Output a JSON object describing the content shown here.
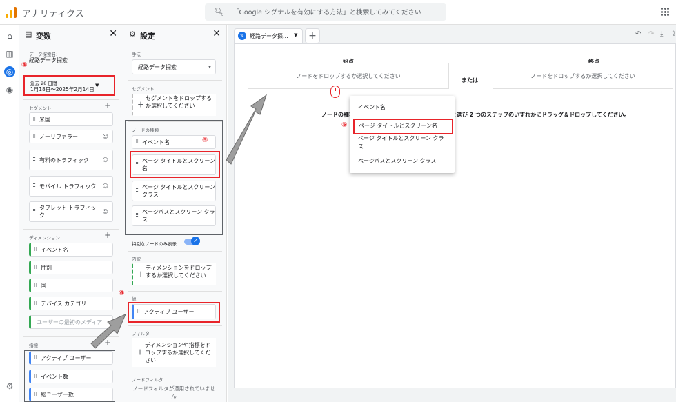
{
  "header": {
    "app_title": "アナリティクス",
    "search_placeholder": "「Google シグナルを有効にする方法」と検索してみてください"
  },
  "left_nav": {
    "icons": [
      "home-icon",
      "reports-icon",
      "explore-icon",
      "advertising-icon",
      "settings-icon"
    ]
  },
  "variables_panel": {
    "title": "変数",
    "exploration_name_label": "データ探索名:",
    "exploration_name": "経路データ探索",
    "date_range_label": "過去 28 日間",
    "date_range": "1月18日～2025年2月14日",
    "segments_label": "セグメント",
    "segments": [
      "米国",
      "ノーリファラー",
      "有料のトラフィック",
      "モバイル トラフィック",
      "タブレット トラフィック"
    ],
    "dimensions_label": "ディメンション",
    "dimensions": [
      "イベント名",
      "性別",
      "国",
      "デバイス カテゴリ",
      "ユーザーの最初のメディア"
    ],
    "metrics_label": "指標",
    "metrics": [
      "アクティブ ユーザー",
      "イベント数",
      "総ユーザー数"
    ]
  },
  "settings_panel": {
    "title": "設定",
    "technique_label": "手法",
    "technique_value": "経路データ探索",
    "segment_label": "セグメント",
    "segment_drop": "セグメントをドロップするか選択してください",
    "node_type_label": "ノードの種類",
    "node_types": [
      "イベント名",
      "ページ タイトルとスクリーン名",
      "ページ タイトルとスクリーン クラス",
      "ページパスとスクリーン クラス"
    ],
    "unique_nodes_label": "特別なノードのみ表示",
    "breakdown_label": "内訳",
    "breakdown_drop": "ディメンションをドロップするか選択してください",
    "values_label": "値",
    "values_item": "アクティブ ユーザー",
    "filter_label": "フィルタ",
    "filter_drop": "ディメンションや指標をドロップするか選択してください",
    "node_filter_label": "ノードフィルタ",
    "node_filter_text": "ノードフィルタが適用されていません"
  },
  "canvas": {
    "tab_label": "経路データ探...",
    "start_label": "始点",
    "end_label": "終点",
    "or_label": "または",
    "start_placeholder": "ノードをドロップするか選択してください",
    "end_placeholder": "ノードをドロップするか選択してください",
    "instruction_left": "ノードの種類",
    "instruction_right": "を選び 2 つのステップのいずれかにドラッグ＆ドロップしてください。"
  },
  "popup_menu": {
    "items": [
      "イベント名",
      "ページ タイトルとスクリーン名",
      "ページ タイトルとスクリーン クラス",
      "ページパスとスクリーン クラス"
    ]
  },
  "annotations": {
    "marker_4": "④",
    "marker_5": "⑤",
    "marker_6": "⑥",
    "annotation_color": "#e8242a"
  }
}
